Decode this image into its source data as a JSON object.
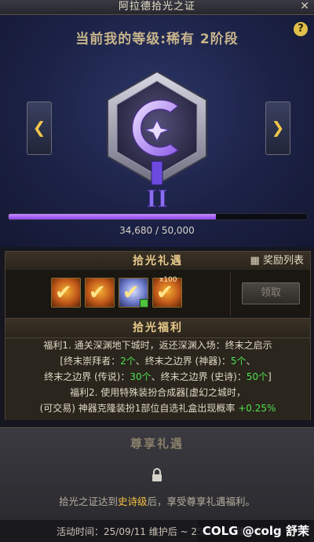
{
  "window": {
    "title": "阿拉德拾光之证",
    "close_icon": "✕"
  },
  "header": {
    "level_text": "当前我的等级:稀有 2阶段",
    "help_icon": "?"
  },
  "nav": {
    "prev_icon": "❮",
    "next_icon": "❯"
  },
  "emblem": {
    "tier": "II"
  },
  "progress": {
    "current": 34680,
    "max": 50000,
    "text": "34,680 / 50,000",
    "ratio": 0.6936
  },
  "rewards": {
    "title": "拾光礼遇",
    "list_label": "奖励列表",
    "claim_label": "领取",
    "items": [
      {
        "name": "reward-item",
        "top_text": ""
      },
      {
        "name": "reward-item",
        "top_text": ""
      },
      {
        "name": "reward-item",
        "top_text": ""
      },
      {
        "name": "reward-item",
        "top_text": "x100"
      }
    ]
  },
  "benefits": {
    "title": "拾光福利",
    "line1": "福利1. 通关深渊地下城时，返还深渊入场：终末之启示",
    "line2_a": "[终末崇拜者：",
    "line2_b": "2个",
    "line2_c": "、终末之边界 (神器)：",
    "line2_d": "5个",
    "line2_e": "、",
    "line3_a": "终末之边界 (传说)：",
    "line3_b": "30个",
    "line3_c": "、终末之边界 (史诗)：",
    "line3_d": "50个",
    "line3_e": "]",
    "line4": "福利2. 使用特殊装扮合成器[虚幻之城时，",
    "line5_a": "(可交易) 神器克隆装扮1部位自选礼盒出现概率",
    "line5_b": "+0.25%"
  },
  "exclusive": {
    "title": "尊享礼遇",
    "text_a": "拾光之证达到",
    "text_epic": "史诗级",
    "text_b": "后，享受尊享礼遇福利。"
  },
  "footer": {
    "event_time": "活动时间：25/09/11 维护后 ~ 25/12/11 维护前"
  },
  "watermark": {
    "text": "COLG @colg 舒茉"
  },
  "colors": {
    "accent": "#c8b58c",
    "progress": "#a56af2",
    "green": "#4fe04f",
    "epic": "#f6c042"
  }
}
